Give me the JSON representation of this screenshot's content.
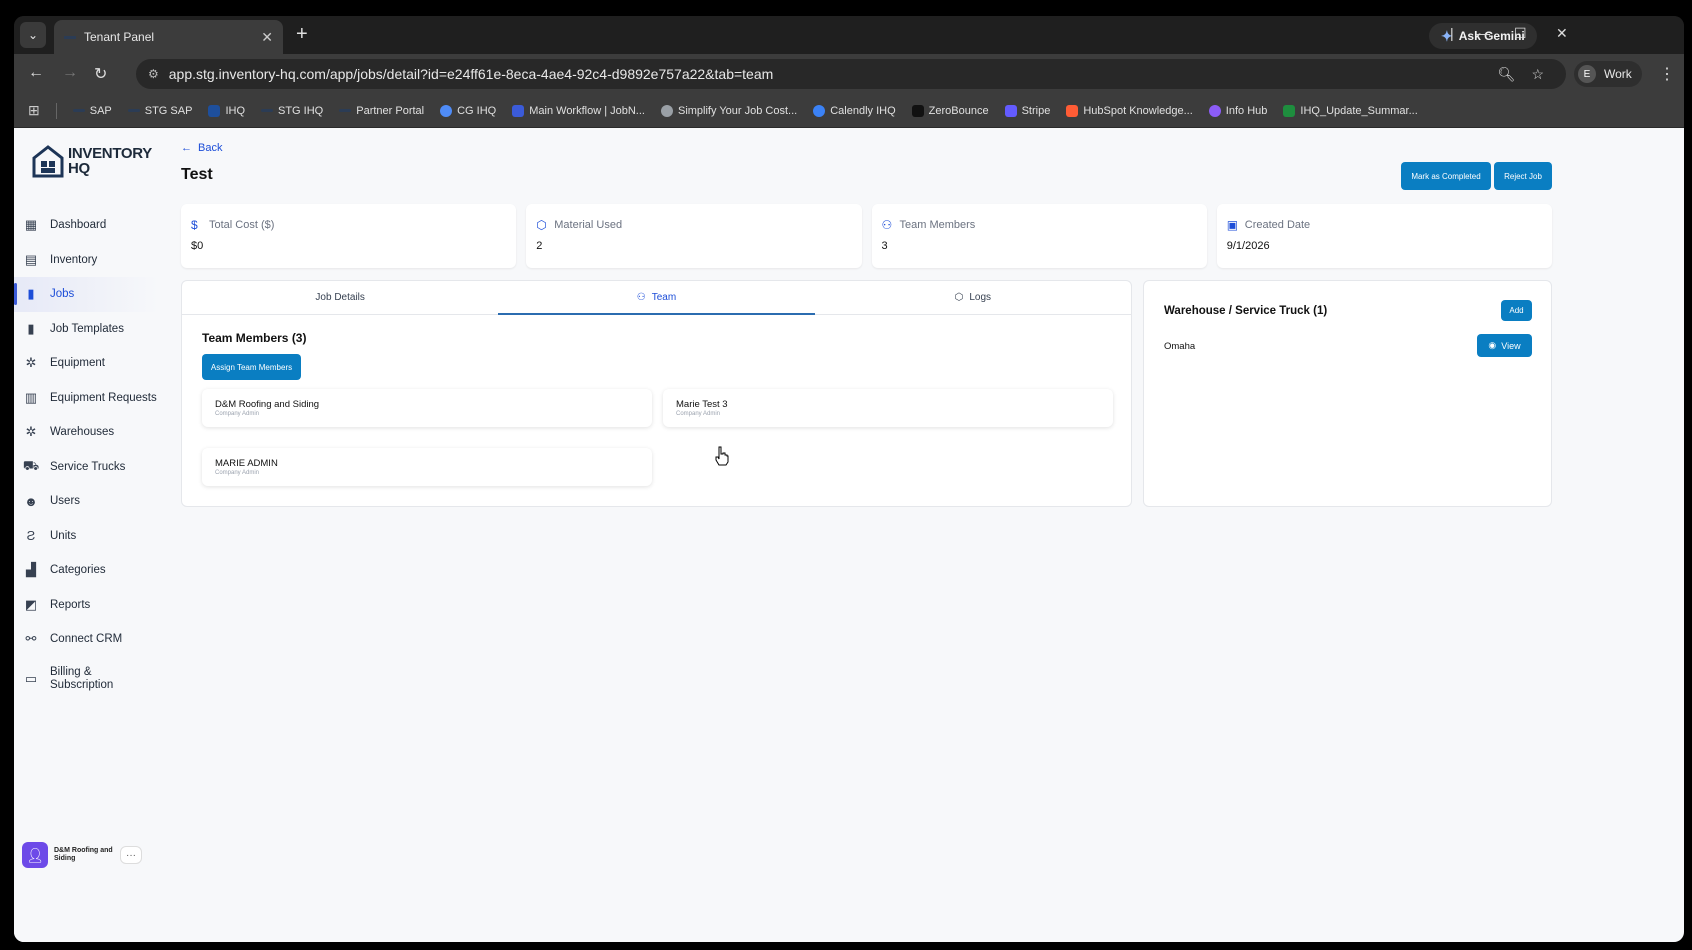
{
  "browser": {
    "tab_title": "Tenant Panel",
    "url": "app.stg.inventory-hq.com/app/jobs/detail?id=e24ff61e-8eca-4ae4-92c4-d9892e757a22&tab=team",
    "gemini_label": "Ask Gemini",
    "profile_initial": "E",
    "profile_label": "Work",
    "bookmarks": [
      {
        "label": "SAP",
        "color": "#2b3c55"
      },
      {
        "label": "STG SAP",
        "color": "#2b3c55"
      },
      {
        "label": "IHQ",
        "color": "#1e4f9c"
      },
      {
        "label": "STG IHQ",
        "color": "#2b3c55"
      },
      {
        "label": "Partner Portal",
        "color": "#2b3c55"
      },
      {
        "label": "CG IHQ",
        "color": "#4f8cf7"
      },
      {
        "label": "Main Workflow | JobN...",
        "color": "#3b5bd9"
      },
      {
        "label": "Simplify Your Job Cost...",
        "color": "#9aa0a6"
      },
      {
        "label": "Calendly IHQ",
        "color": "#3b82f6"
      },
      {
        "label": "ZeroBounce",
        "color": "#111111"
      },
      {
        "label": "Stripe",
        "color": "#635bff"
      },
      {
        "label": "HubSpot Knowledge...",
        "color": "#ff5c35"
      },
      {
        "label": "Info Hub",
        "color": "#8b5cf6"
      },
      {
        "label": "IHQ_Update_Summar...",
        "color": "#1e8e3e"
      }
    ]
  },
  "sidebar": {
    "brand_line1": "INVENTORY",
    "brand_line2": "HQ",
    "items": [
      {
        "label": "Dashboard",
        "icon": "grid-icon"
      },
      {
        "label": "Inventory",
        "icon": "boxes-icon"
      },
      {
        "label": "Jobs",
        "icon": "briefcase-icon",
        "active": true
      },
      {
        "label": "Job Templates",
        "icon": "template-icon"
      },
      {
        "label": "Equipment",
        "icon": "wrench-icon"
      },
      {
        "label": "Equipment Requests",
        "icon": "clipboard-icon"
      },
      {
        "label": "Warehouses",
        "icon": "warehouse-icon"
      },
      {
        "label": "Service Trucks",
        "icon": "truck-icon"
      },
      {
        "label": "Users",
        "icon": "users-icon"
      },
      {
        "label": "Units",
        "icon": "units-icon"
      },
      {
        "label": "Categories",
        "icon": "categories-icon"
      },
      {
        "label": "Reports",
        "icon": "chart-icon"
      },
      {
        "label": "Connect CRM",
        "icon": "network-icon"
      },
      {
        "label": "Billing & Subscription",
        "icon": "card-icon"
      }
    ],
    "user_name": "D&M Roofing and Siding",
    "more_label": "···"
  },
  "header": {
    "back_label": "Back",
    "title": "Test",
    "mark_completed_label": "Mark as Completed",
    "reject_label": "Reject Job"
  },
  "stats": [
    {
      "label": "Total Cost ($)",
      "value": "$0",
      "icon": "dollar-icon"
    },
    {
      "label": "Material Used",
      "value": "2",
      "icon": "cube-icon"
    },
    {
      "label": "Team Members",
      "value": "3",
      "icon": "users-icon"
    },
    {
      "label": "Created Date",
      "value": "9/1/2026",
      "icon": "calendar-icon"
    }
  ],
  "tabs": [
    {
      "label": "Job Details"
    },
    {
      "label": "Team",
      "active": true
    },
    {
      "label": "Logs"
    }
  ],
  "team": {
    "heading": "Team Members (3)",
    "assign_label": "Assign Team Members",
    "members": [
      {
        "name": "D&M Roofing and Siding",
        "role": "Company Admin"
      },
      {
        "name": "Marie Test 3",
        "role": "Company Admin"
      },
      {
        "name": "MARIE ADMIN",
        "role": "Company Admin"
      }
    ]
  },
  "warehouse": {
    "title": "Warehouse / Service Truck (1)",
    "add_label": "Add",
    "name": "Omaha",
    "view_label": "View"
  }
}
